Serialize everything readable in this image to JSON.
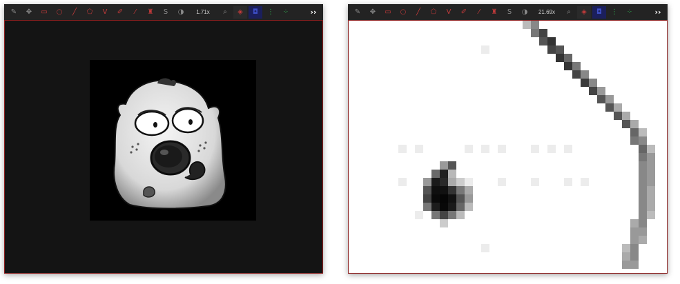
{
  "viewers": [
    {
      "zoom_label": "1.71x",
      "toolbar_icons": [
        "brush-icon",
        "pan-icon",
        "rectangle-icon",
        "ellipse-icon",
        "line-icon",
        "polygon-icon",
        "vector-icon",
        "pencil-icon",
        "eraser-icon",
        "stamp-icon",
        "sharpen-icon",
        "contrast-icon",
        "magnify-icon",
        "red-channel-icon",
        "blue-channel-icon",
        "green-tree-icon",
        "green-nodes-icon"
      ],
      "more_label": "››"
    },
    {
      "zoom_label": "21.69x",
      "toolbar_icons": [
        "brush-icon",
        "pan-icon",
        "rectangle-icon",
        "ellipse-icon",
        "line-icon",
        "polygon-icon",
        "vector-icon",
        "pencil-icon",
        "eraser-icon",
        "stamp-icon",
        "sharpen-icon",
        "contrast-icon",
        "magnify-icon",
        "red-channel-icon",
        "blue-channel-icon",
        "green-tree-icon",
        "green-nodes-icon"
      ],
      "more_label": "››"
    }
  ],
  "colors": {
    "frame_border": "#8b1e1e",
    "toolbar_bg": "#232323",
    "accent_red": "#c23a3a",
    "accent_blue": "#3d4ec4",
    "accent_green": "#2fb04f"
  }
}
